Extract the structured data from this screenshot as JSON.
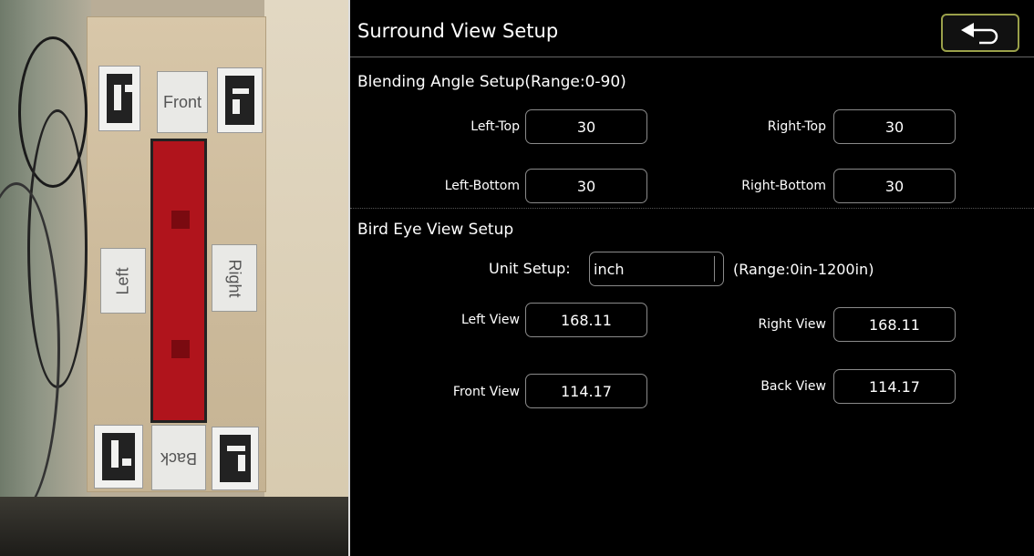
{
  "camera": {
    "labels": {
      "front": "Front",
      "back": "Back",
      "left": "Left",
      "right": "Right"
    }
  },
  "header": {
    "title": "Surround View Setup",
    "back_icon": "back-arrow-icon"
  },
  "blending": {
    "title": "Blending Angle Setup(Range:0-90)",
    "left_top": {
      "label": "Left-Top",
      "value": "30"
    },
    "right_top": {
      "label": "Right-Top",
      "value": "30"
    },
    "left_bottom": {
      "label": "Left-Bottom",
      "value": "30"
    },
    "right_bottom": {
      "label": "Right-Bottom",
      "value": "30"
    }
  },
  "bird_eye": {
    "title": "Bird Eye View Setup",
    "unit_label": "Unit Setup:",
    "unit_value": "inch",
    "range": "(Range:0in-1200in)",
    "left_view": {
      "label": "Left View",
      "value": "168.11"
    },
    "right_view": {
      "label": "Right View",
      "value": "168.11"
    },
    "front_view": {
      "label": "Front View",
      "value": "114.17"
    },
    "back_view": {
      "label": "Back View",
      "value": "114.17"
    }
  },
  "colors": {
    "accent_border": "#9aa04a",
    "car_red": "#b0141c",
    "background": "#000000"
  }
}
